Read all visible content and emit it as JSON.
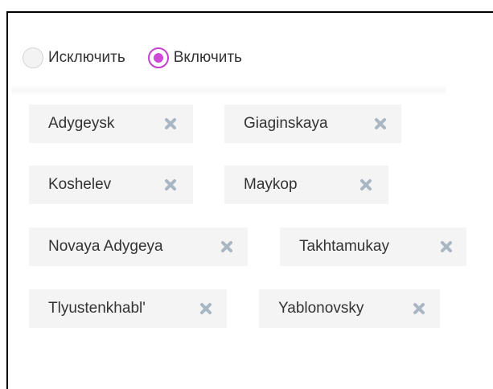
{
  "filter_mode": {
    "options": [
      {
        "label": "Исключить",
        "checked": false
      },
      {
        "label": "Включить",
        "checked": true
      }
    ]
  },
  "tags": [
    {
      "label": "Adygeysk"
    },
    {
      "label": "Giaginskaya"
    },
    {
      "label": "Koshelev"
    },
    {
      "label": "Maykop"
    },
    {
      "label": "Novaya Adygeya"
    },
    {
      "label": "Takhtamukay"
    },
    {
      "label": "Tlyustenkhabl'"
    },
    {
      "label": "Yablonovsky"
    }
  ],
  "colors": {
    "accent": "#cf49d9",
    "tag_background": "#f4f4f4",
    "remove_icon": "#a9b6c4",
    "text": "#333333"
  },
  "icons": {
    "remove": "close-x-icon"
  }
}
